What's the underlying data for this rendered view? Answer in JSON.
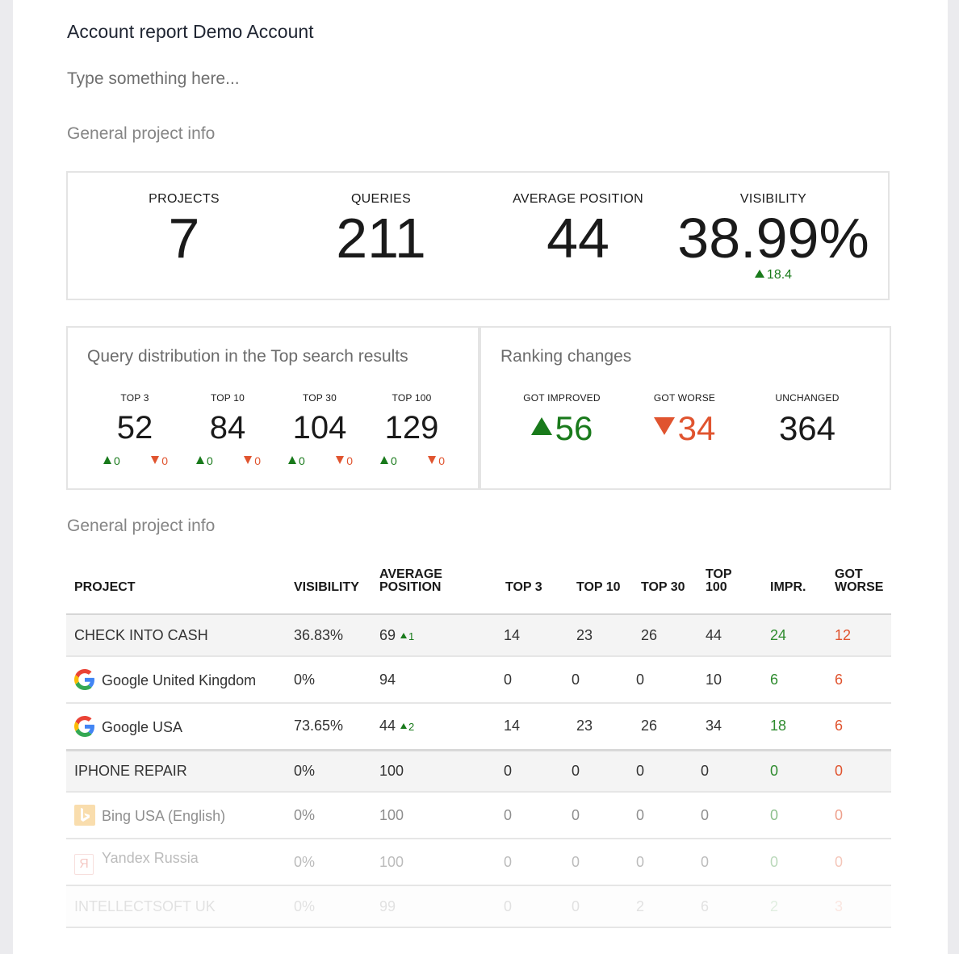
{
  "report": {
    "title": "Account report Demo Account",
    "note_placeholder": "Type something here..."
  },
  "general_info": {
    "heading": "General project info",
    "stats": [
      {
        "label": "PROJECTS",
        "value": "7"
      },
      {
        "label": "QUERIES",
        "value": "211"
      },
      {
        "label": "AVERAGE POSITION",
        "value": "44"
      },
      {
        "label": "VISIBILITY",
        "value": "38.99%",
        "delta": "18.4"
      }
    ]
  },
  "distribution": {
    "title": "Query distribution in the Top search results",
    "columns": [
      {
        "label": "TOP 3",
        "value": "52",
        "up": "0",
        "down": "0"
      },
      {
        "label": "TOP 10",
        "value": "84",
        "up": "0",
        "down": "0"
      },
      {
        "label": "TOP 30",
        "value": "104",
        "up": "0",
        "down": "0"
      },
      {
        "label": "TOP 100",
        "value": "129",
        "up": "0",
        "down": "0"
      }
    ]
  },
  "ranking": {
    "title": "Ranking changes",
    "improved_label": "GOT IMPROVED",
    "improved_value": "56",
    "worse_label": "GOT WORSE",
    "worse_value": "34",
    "unchanged_label": "UNCHANGED",
    "unchanged_value": "364"
  },
  "table": {
    "heading": "General project info",
    "headers": {
      "project": "PROJECT",
      "visibility": "VISIBILITY",
      "avg_position": "AVERAGE POSITION",
      "top3": "TOP 3",
      "top10": "TOP 10",
      "top30": "TOP 30",
      "top100": "TOP 100",
      "impr": "IMPR.",
      "worse": "GOT WORSE"
    },
    "rows": [
      {
        "name": "CHECK INTO CASH",
        "visibility": "36.83%",
        "avg": "69",
        "avg_delta": "1",
        "top3": "14",
        "top10": "23",
        "top30": "26",
        "top100": "44",
        "impr": "24",
        "worse": "12"
      },
      {
        "name": "Google United Kingdom",
        "icon": "google-icon",
        "visibility": "0%",
        "avg": "94",
        "top3": "0",
        "top10": "0",
        "top30": "0",
        "top100": "10",
        "impr": "6",
        "worse": "6"
      },
      {
        "name": "Google USA",
        "icon": "google-icon",
        "visibility": "73.65%",
        "avg": "44",
        "avg_delta": "2",
        "top3": "14",
        "top10": "23",
        "top30": "26",
        "top100": "34",
        "impr": "18",
        "worse": "6"
      },
      {
        "name": "IPHONE REPAIR",
        "visibility": "0%",
        "avg": "100",
        "top3": "0",
        "top10": "0",
        "top30": "0",
        "top100": "0",
        "impr": "0",
        "worse": "0"
      },
      {
        "name": "Bing USA (English)",
        "icon": "bing-icon",
        "visibility": "0%",
        "avg": "100",
        "top3": "0",
        "top10": "0",
        "top30": "0",
        "top100": "0",
        "impr": "0",
        "worse": "0"
      },
      {
        "name": "Yandex Russia",
        "icon": "yandex-icon",
        "icon_glyph": "Я",
        "visibility": "0%",
        "avg": "100",
        "top3": "0",
        "top10": "0",
        "top30": "0",
        "top100": "0",
        "impr": "0",
        "worse": "0"
      },
      {
        "name": "INTELLECTSOFT UK",
        "visibility": "0%",
        "avg": "99",
        "top3": "0",
        "top10": "0",
        "top30": "2",
        "top100": "6",
        "impr": "2",
        "worse": "3"
      }
    ]
  },
  "colors": {
    "positive": "#197a1b",
    "negative": "#e0542f",
    "border": "#e4e4e4"
  }
}
